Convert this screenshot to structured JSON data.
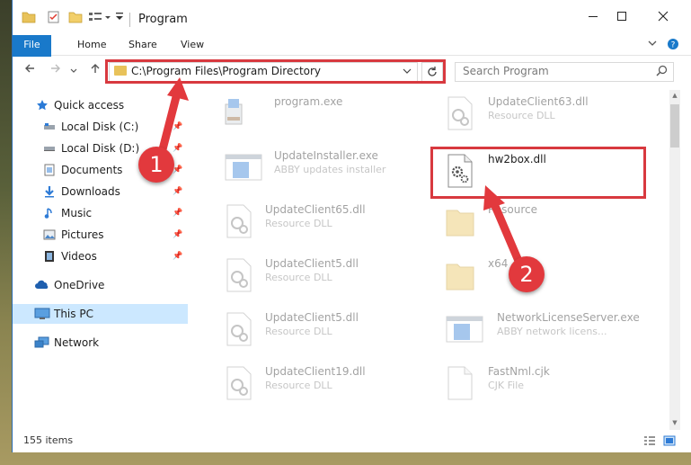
{
  "window": {
    "title": "Program",
    "controls": [
      "minimize",
      "maximize",
      "close"
    ]
  },
  "ribbon": {
    "tabs": [
      "File",
      "Home",
      "Share",
      "View"
    ]
  },
  "navigation": {
    "address": "C:\\Program Files\\Program Directory",
    "search_placeholder": "Search Program"
  },
  "sidebar": {
    "items": [
      {
        "label": "Quick access",
        "icon": "star-icon"
      },
      {
        "label": "Local Disk (C:)",
        "icon": "drive-icon",
        "pinned": true
      },
      {
        "label": "Local Disk (D:)",
        "icon": "drive-icon",
        "pinned": true
      },
      {
        "label": "Documents",
        "icon": "documents-icon",
        "pinned": true
      },
      {
        "label": "Downloads",
        "icon": "download-icon",
        "pinned": true
      },
      {
        "label": "Music",
        "icon": "music-icon",
        "pinned": true
      },
      {
        "label": "Pictures",
        "icon": "pictures-icon",
        "pinned": true
      },
      {
        "label": "Videos",
        "icon": "videos-icon",
        "pinned": true
      },
      {
        "label": "OneDrive",
        "icon": "cloud-icon"
      },
      {
        "label": "This PC",
        "icon": "computer-icon",
        "selected": true
      },
      {
        "label": "Network",
        "icon": "network-icon"
      }
    ]
  },
  "files": [
    {
      "name": "program.exe",
      "description": "",
      "icon": "installer-icon"
    },
    {
      "name": "UpdateClient63.dll",
      "description": "Resource DLL",
      "icon": "dll-icon"
    },
    {
      "name": "UpdateInstaller.exe",
      "description": "ABBY updates installer",
      "icon": "app-window-icon"
    },
    {
      "name": "hw2box.dll",
      "description": "",
      "icon": "dll-gear-icon",
      "highlighted": true
    },
    {
      "name": "UpdateClient65.dll",
      "description": "Resource DLL",
      "icon": "dll-icon"
    },
    {
      "name": "Resource",
      "description": "",
      "icon": "folder-icon"
    },
    {
      "name": "UpdateClient5.dll",
      "description": "Resource DLL",
      "icon": "dll-icon"
    },
    {
      "name": "x64",
      "description": "",
      "icon": "folder-icon"
    },
    {
      "name": "UpdateClient5.dll",
      "description": "Resource DLL",
      "icon": "dll-icon"
    },
    {
      "name": "NetworkLicenseServer.exe",
      "description": "ABBY network licens...",
      "icon": "app-window-icon"
    },
    {
      "name": "UpdateClient19.dll",
      "description": "Resource DLL",
      "icon": "dll-icon"
    },
    {
      "name": "FastNml.cjk",
      "description": "CJK File",
      "icon": "file-icon"
    }
  ],
  "status": {
    "item_count": "155 items"
  },
  "callouts": [
    "1",
    "2"
  ],
  "colors": {
    "accent": "#1979ca",
    "highlight_red": "#d8393f",
    "selection": "#cce8ff"
  }
}
